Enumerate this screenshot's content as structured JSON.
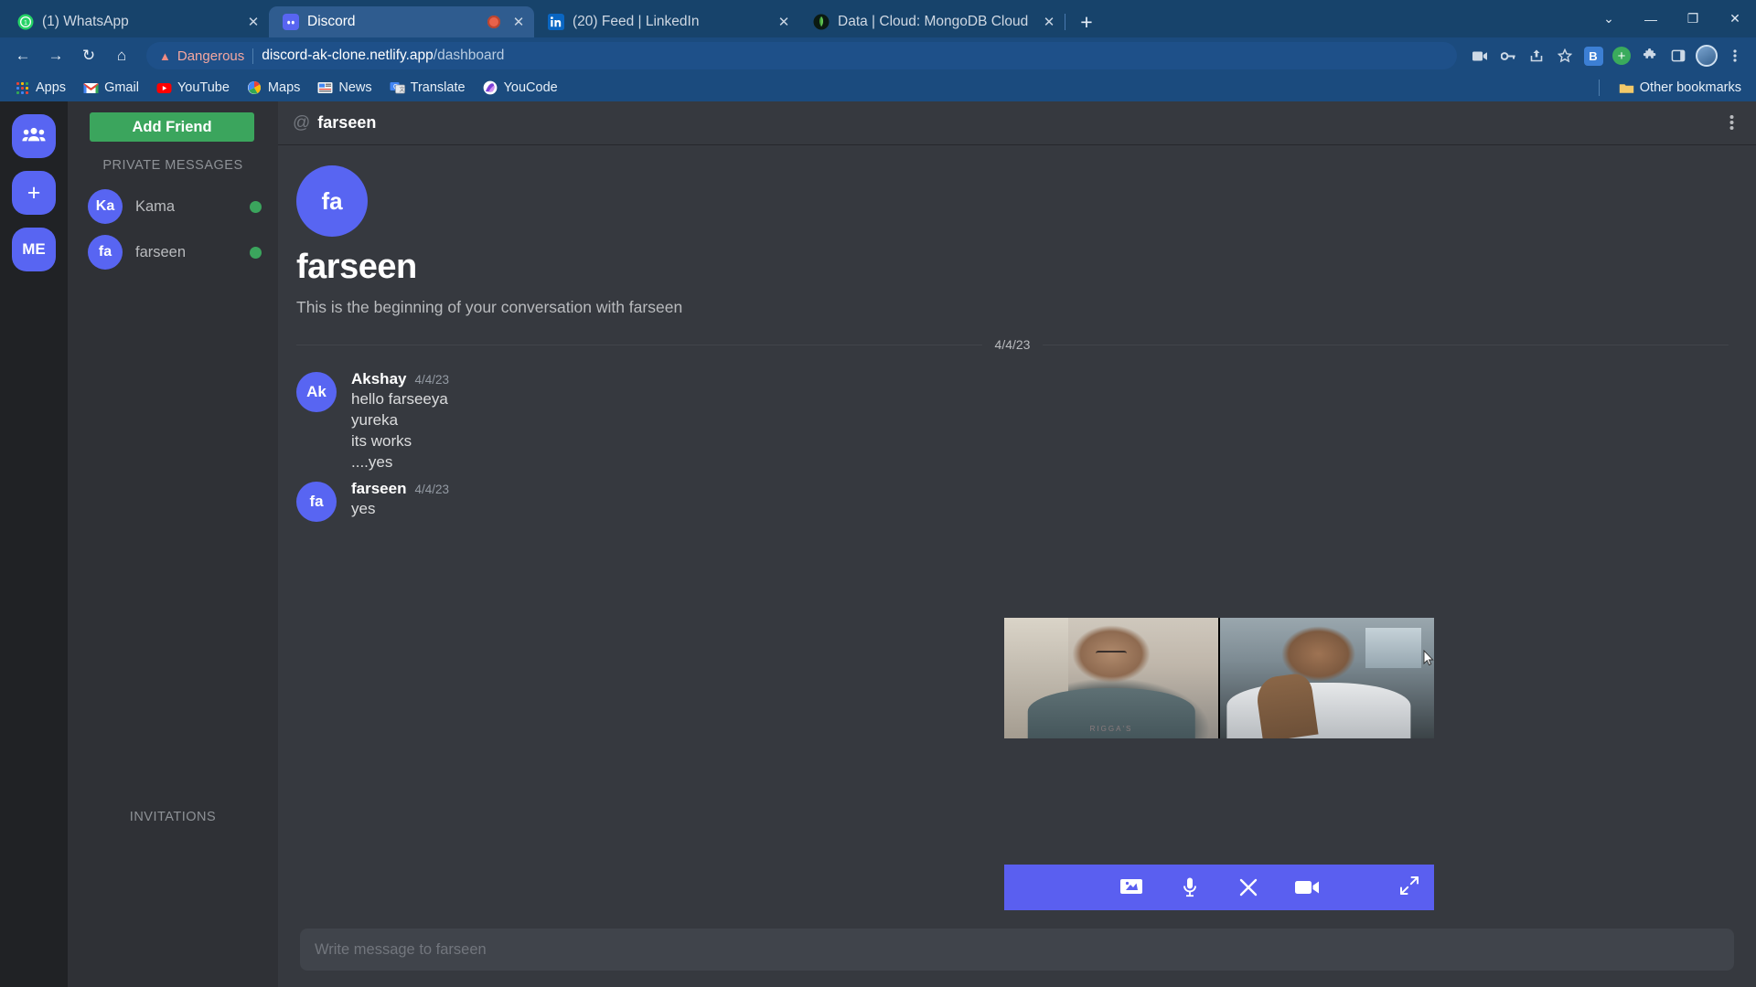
{
  "browser": {
    "tabs": [
      {
        "title": "(1) WhatsApp",
        "favicon": "whatsapp-icon",
        "active": false,
        "recording": false
      },
      {
        "title": "Discord",
        "favicon": "discord-icon",
        "active": true,
        "recording": true
      },
      {
        "title": "(20) Feed | LinkedIn",
        "favicon": "linkedin-icon",
        "active": false,
        "recording": false
      },
      {
        "title": "Data | Cloud: MongoDB Cloud",
        "favicon": "mongodb-icon",
        "active": false,
        "recording": false
      }
    ],
    "new_tab_label": "+",
    "tab_close_label": "✕",
    "window_controls": {
      "list": "⌄",
      "minimize": "—",
      "maximize": "❐",
      "close": "✕"
    },
    "nav": {
      "back": "←",
      "forward": "→",
      "reload": "↻",
      "home": "⌂"
    },
    "omnibox": {
      "security_label": "Dangerous",
      "security_icon": "warning-triangle-icon",
      "url_host": "discord-ak-clone.netlify.app",
      "url_path": "/dashboard"
    },
    "toolbar_right": {
      "video_icon": "video-camera-icon",
      "key_icon": "password-key-icon",
      "share_icon": "share-icon",
      "star_icon": "bookmark-star-icon",
      "b_ext_label": "B",
      "plus_ext_label": "+",
      "puzzle_icon": "extensions-puzzle-icon",
      "sidepanel_icon": "side-panel-icon",
      "menu_icon": "three-dot-menu-icon"
    },
    "bookmarks": [
      {
        "label": "Apps",
        "icon": "apps-grid-icon"
      },
      {
        "label": "Gmail",
        "icon": "gmail-icon"
      },
      {
        "label": "YouTube",
        "icon": "youtube-icon"
      },
      {
        "label": "Maps",
        "icon": "maps-icon"
      },
      {
        "label": "News",
        "icon": "news-icon"
      },
      {
        "label": "Translate",
        "icon": "translate-icon"
      },
      {
        "label": "YouCode",
        "icon": "youcode-icon"
      }
    ],
    "other_bookmarks": {
      "label": "Other bookmarks",
      "icon": "folder-icon"
    }
  },
  "app": {
    "rail": [
      {
        "name": "friends",
        "glyph": "👥",
        "icon": "people-icon"
      },
      {
        "name": "add-server",
        "glyph": "+",
        "icon": "plus-icon"
      },
      {
        "name": "me",
        "glyph": "ME",
        "icon": "me-avatar"
      }
    ],
    "sidebar": {
      "add_friend_label": "Add Friend",
      "section_label": "PRIVATE MESSAGES",
      "invitations_label": "INVITATIONS",
      "dms": [
        {
          "initials": "Ka",
          "name": "Kama",
          "status": "online"
        },
        {
          "initials": "fa",
          "name": "farseen",
          "status": "online"
        }
      ]
    },
    "chat": {
      "header": {
        "at": "@",
        "name": "farseen",
        "menu_icon": "vertical-dots-icon"
      },
      "intro": {
        "avatar_initials": "fa",
        "name": "farseen",
        "subtitle": "This is the beginning of your conversation with farseen"
      },
      "date_divider": "4/4/23",
      "messages": [
        {
          "avatar_initials": "Ak",
          "author": "Akshay",
          "timestamp": "4/4/23",
          "lines": [
            "hello farseeya",
            "yureka",
            "its works",
            "....yes"
          ]
        },
        {
          "avatar_initials": "fa",
          "author": "farseen",
          "timestamp": "4/4/23",
          "lines": [
            "yes"
          ]
        }
      ],
      "composer_placeholder": "Write message to farseen"
    },
    "call": {
      "participants": [
        {
          "label": "participant-1",
          "shirt_text": "RIGGA'S"
        },
        {
          "label": "participant-2",
          "shirt_text": ""
        }
      ],
      "controls": [
        {
          "name": "screen-share-button",
          "icon": "screen-share-icon"
        },
        {
          "name": "microphone-button",
          "icon": "microphone-icon"
        },
        {
          "name": "end-call-button",
          "icon": "close-x-icon"
        },
        {
          "name": "camera-button",
          "icon": "video-camera-icon"
        },
        {
          "name": "expand-button",
          "icon": "expand-arrows-icon"
        }
      ]
    }
  },
  "colors": {
    "accent_blurple": "#5865f2",
    "green": "#3ba55d",
    "call_bar": "#5a5ff0",
    "chat_bg": "#36393f",
    "sidebar_bg": "#2f3136",
    "rail_bg": "#202225",
    "browser_blue": "#1b4b7e",
    "danger_red": "#f4a7a0"
  }
}
